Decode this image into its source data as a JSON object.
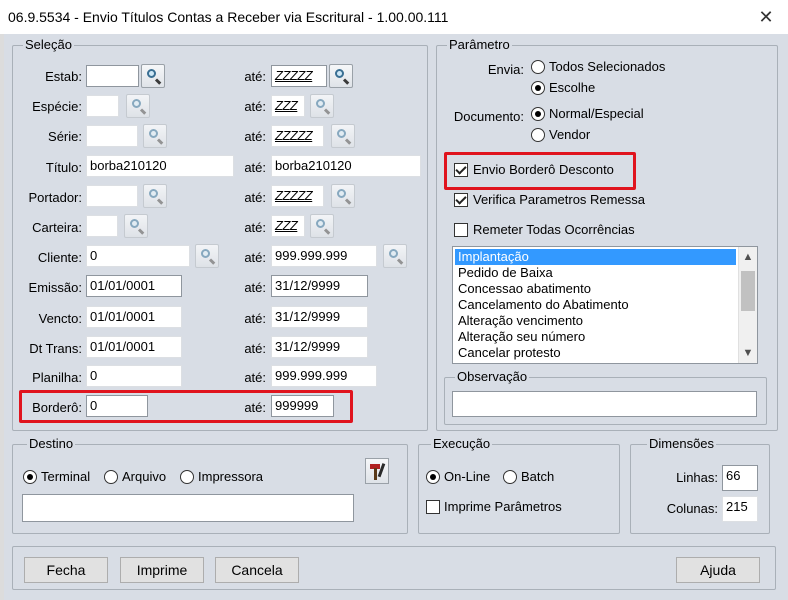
{
  "window": {
    "title": "06.9.5534 - Envio Títulos Contas a Receber via Escritural - 1.00.00.111",
    "close_glyph": "✕"
  },
  "selecao": {
    "legend": "Seleção",
    "ate_label": "até:",
    "rows": [
      {
        "label": "Estab:",
        "from": "",
        "to": "ZZZZZ"
      },
      {
        "label": "Espécie:",
        "from": "",
        "to": "ZZZ"
      },
      {
        "label": "Série:",
        "from": "",
        "to": "ZZZZZ"
      },
      {
        "label": "Título:",
        "from": "borba210120",
        "to": "borba210120"
      },
      {
        "label": "Portador:",
        "from": "",
        "to": "ZZZZZ"
      },
      {
        "label": "Carteira:",
        "from": "",
        "to": "ZZZ"
      },
      {
        "label": "Cliente:",
        "from": "0",
        "to": "999.999.999"
      },
      {
        "label": "Emissão:",
        "from": "01/01/0001",
        "to": "31/12/9999"
      },
      {
        "label": "Vencto:",
        "from": "01/01/0001",
        "to": "31/12/9999"
      },
      {
        "label": "Dt Trans:",
        "from": "01/01/0001",
        "to": "31/12/9999"
      },
      {
        "label": "Planilha:",
        "from": "0",
        "to": "999.999.999"
      },
      {
        "label": "Borderô:",
        "from": "0",
        "to": "999999"
      }
    ]
  },
  "parametro": {
    "legend": "Parâmetro",
    "envia_label": "Envia:",
    "envia_options": [
      "Todos Selecionados",
      "Escolhe"
    ],
    "envia_selected": "Escolhe",
    "documento_label": "Documento:",
    "documento_options": [
      "Normal/Especial",
      "Vendor"
    ],
    "documento_selected": "Normal/Especial",
    "checks": [
      {
        "label": "Envio Borderô Desconto",
        "checked": true
      },
      {
        "label": "Verifica Parametros Remessa",
        "checked": true
      },
      {
        "label": "Remeter Todas Ocorrências",
        "checked": false
      }
    ],
    "ocorrencias": [
      "Implantação",
      "Pedido de Baixa",
      "Concessao abatimento",
      "Cancelamento do Abatimento",
      "Alteração vencimento",
      "Alteração seu número",
      "Cancelar protesto"
    ],
    "ocorrencia_selected": "Implantação",
    "observacao_legend": "Observação",
    "observacao_value": ""
  },
  "destino": {
    "legend": "Destino",
    "options": [
      "Terminal",
      "Arquivo",
      "Impressora"
    ],
    "selected": "Terminal",
    "path_value": ""
  },
  "execucao": {
    "legend": "Execução",
    "options": [
      "On-Line",
      "Batch"
    ],
    "selected": "On-Line",
    "imprime_label": "Imprime Parâmetros",
    "imprime_checked": false
  },
  "dimensoes": {
    "legend": "Dimensões",
    "linhas_label": "Linhas:",
    "linhas_value": "66",
    "colunas_label": "Colunas:",
    "colunas_value": "215"
  },
  "buttons": {
    "fecha": "Fecha",
    "imprime": "Imprime",
    "cancela": "Cancela",
    "ajuda": "Ajuda"
  },
  "colors": {
    "highlight": "#e0141e",
    "selection": "#3399ff",
    "panel": "#d8dde5"
  },
  "icons": {
    "lookup": "magnifier-icon",
    "config": "tools-icon"
  }
}
